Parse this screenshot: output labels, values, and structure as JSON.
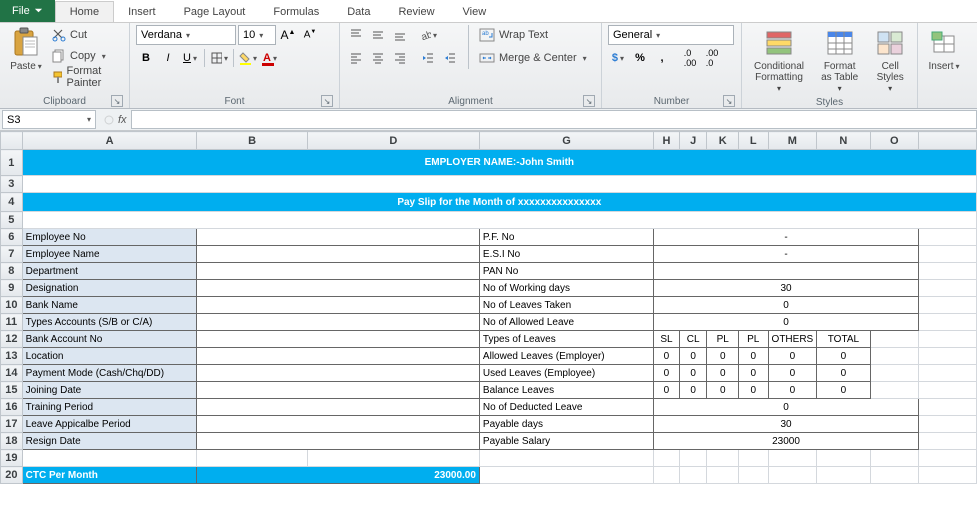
{
  "tabs": {
    "file": "File",
    "home": "Home",
    "insert": "Insert",
    "page_layout": "Page Layout",
    "formulas": "Formulas",
    "data": "Data",
    "review": "Review",
    "view": "View"
  },
  "clipboard": {
    "paste": "Paste",
    "cut": "Cut",
    "copy": "Copy",
    "format_painter": "Format Painter",
    "label": "Clipboard"
  },
  "font": {
    "name": "Verdana",
    "size": "10",
    "label": "Font"
  },
  "alignment": {
    "wrap": "Wrap Text",
    "merge": "Merge & Center",
    "label": "Alignment"
  },
  "number": {
    "format": "General",
    "label": "Number"
  },
  "styles": {
    "cond": "Conditional Formatting",
    "table": "Format as Table",
    "cell": "Cell Styles",
    "label": "Styles"
  },
  "cells": {
    "insert": "Insert"
  },
  "namebox": "S3",
  "fx": "",
  "cols": [
    "A",
    "B",
    "D",
    "G",
    "H",
    "J",
    "K",
    "L",
    "M",
    "N",
    "O"
  ],
  "sheet": {
    "title": "EMPLOYER NAME:-John Smith",
    "subtitle": "Pay Slip for the Month of xxxxxxxxxxxxxxx",
    "left_labels": [
      "Employee No",
      "Employee Name",
      "Department",
      "Designation",
      "Bank Name",
      "Types Accounts (S/B or C/A)",
      "Bank Account No",
      "Location",
      "Payment Mode (Cash/Chq/DD)",
      "Joining Date",
      "Training Period",
      "Leave Appicalbe Period",
      "Resign Date"
    ],
    "right_labels": [
      "P.F. No",
      "E.S.I No",
      "PAN No",
      "No of Working days",
      "No of Leaves Taken",
      "No of Allowed Leave",
      "Types of Leaves",
      "Allowed Leaves (Employer)",
      "Used Leaves (Employee)",
      "Balance Leaves",
      "No of Deducted Leave",
      "Payable days",
      "Payable Salary"
    ],
    "right_vals_single": {
      "0": "-",
      "1": "-",
      "2": "",
      "3": "30",
      "4": "0",
      "5": "0",
      "10": "0",
      "11": "30",
      "12": "23000"
    },
    "leave_hdrs": [
      "SL",
      "CL",
      "PL",
      "PL",
      "OTHERS",
      "TOTAL"
    ],
    "leave_rows": [
      [
        "0",
        "0",
        "0",
        "0",
        "0",
        "0"
      ],
      [
        "0",
        "0",
        "0",
        "0",
        "0",
        "0"
      ],
      [
        "0",
        "0",
        "0",
        "0",
        "0",
        "0"
      ]
    ],
    "ctc_label": "CTC Per Month",
    "ctc_val": "23000.00"
  }
}
